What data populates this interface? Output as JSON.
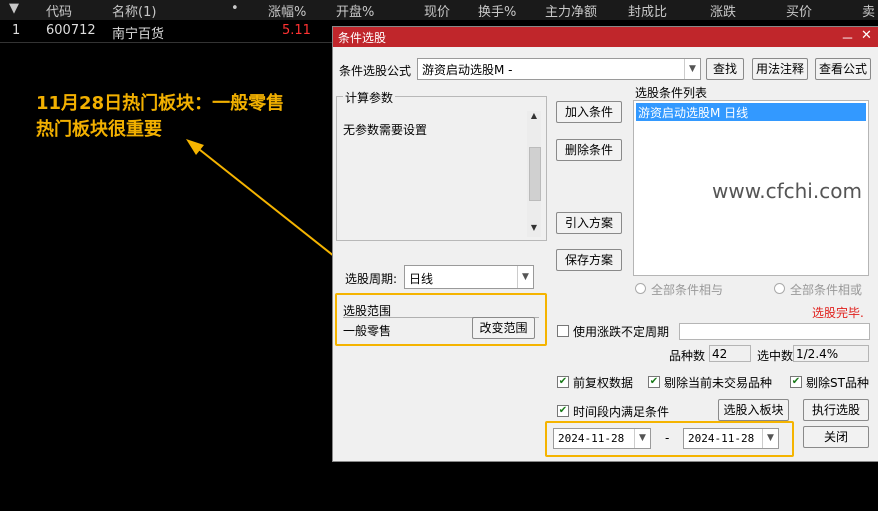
{
  "table": {
    "headers": [
      "▼",
      "代码",
      "名称(1)",
      "•",
      "涨幅%",
      "开盘%",
      "现价",
      "换手%",
      "主力净额",
      "封成比",
      "涨跌",
      "买价",
      "卖"
    ],
    "row": {
      "index": "1",
      "code": "600712",
      "name": "南宁百货",
      "change": "5.11"
    }
  },
  "annotation": {
    "line1": "11月28日热门板块：一般零售",
    "line2": "热门板块很重要"
  },
  "dialog": {
    "title": "条件选股",
    "min_icon": "－",
    "close_icon": "✕",
    "formula_label": "条件选股公式",
    "formula_value": "游资启动选股M  -",
    "find_btn": "查找",
    "usage_btn": "用法注释",
    "view_formula_btn": "查看公式",
    "params_caption": "计算参数",
    "params_text": "无参数需要设置",
    "add_btn": "加入条件",
    "delete_btn": "删除条件",
    "import_btn": "引入方案",
    "save_btn": "保存方案",
    "list_caption": "选股条件列表",
    "list_items": [
      "游资启动选股M  日线"
    ],
    "watermark": "www.cfchi.com",
    "radio_and": "全部条件相与",
    "radio_or": "全部条件相或",
    "status": "选股完毕.",
    "period_label": "选股周期:",
    "period_value": "日线",
    "range_caption": "选股范围",
    "range_value": "一般零售",
    "change_range_btn": "改变范围",
    "use_irregular_period": "使用涨跌不定周期",
    "count_label": "品种数",
    "count_value": "42",
    "selected_label": "选中数",
    "selected_value": "1/2.4%",
    "prior_adj": "前复权数据",
    "exclude_untraded": "剔除当前未交易品种",
    "exclude_st": "剔除ST品种",
    "time_period": "时间段内满足条件",
    "to_block_btn": "选股入板块",
    "execute_btn": "执行选股",
    "date_from": "2024-11-28",
    "date_sep": "-",
    "date_to": "2024-11-28",
    "close_btn": "关闭",
    "check_mark": "✔"
  },
  "colors": {
    "title_bar": "#c0262b",
    "highlight": "#f5b400",
    "up_red": "#ff3232",
    "selected_row": "#3399ff"
  }
}
